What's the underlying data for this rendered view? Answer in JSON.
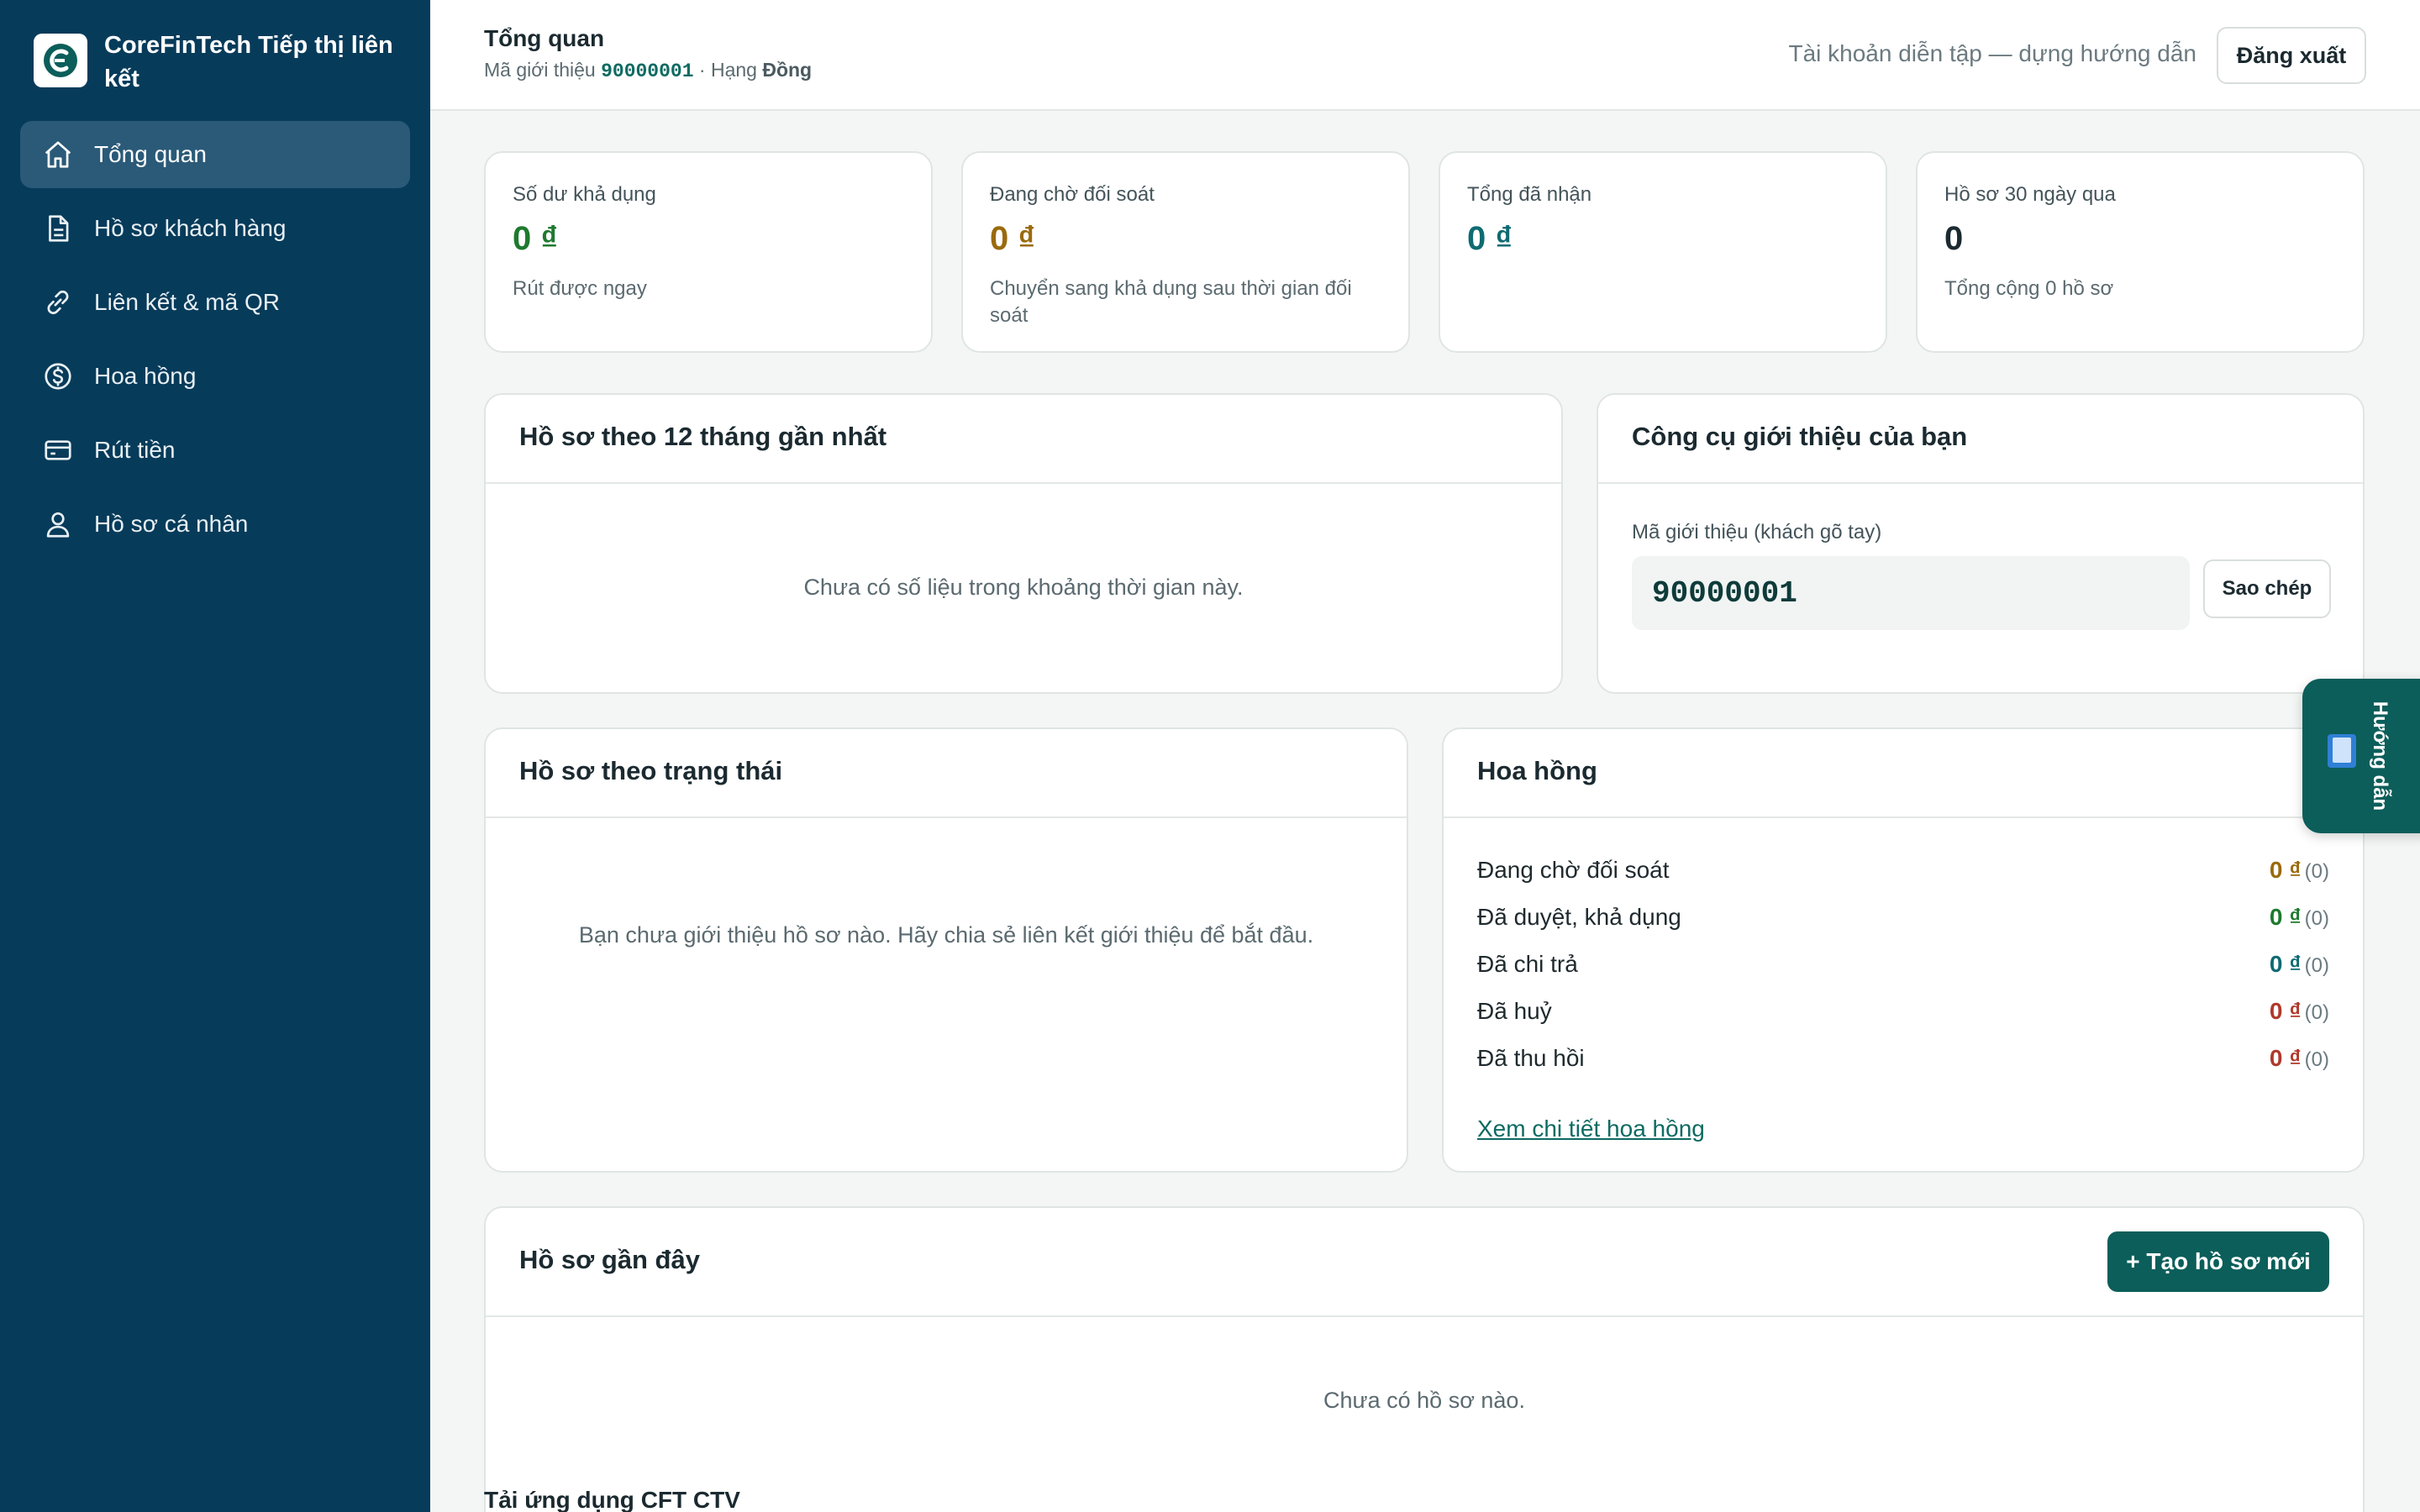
{
  "brand": {
    "name": "CoreFinTech Tiếp thị liên kết"
  },
  "nav": {
    "items": [
      {
        "label": "Tổng quan",
        "icon": "home-icon",
        "active": true
      },
      {
        "label": "Hồ sơ khách hàng",
        "icon": "document-icon"
      },
      {
        "label": "Liên kết & mã QR",
        "icon": "link-icon"
      },
      {
        "label": "Hoa hồng",
        "icon": "dollar-circle-icon"
      },
      {
        "label": "Rút tiền",
        "icon": "credit-card-icon"
      },
      {
        "label": "Hồ sơ cá nhân",
        "icon": "user-icon"
      }
    ]
  },
  "header": {
    "title": "Tổng quan",
    "sub_prefix": "Mã giới thiệu",
    "referral_code": "90000001",
    "rank_prefix": "· Hạng",
    "rank": "Đồng",
    "demo_note": "Tài khoản diễn tập — dựng hướng dẫn",
    "logout_label": "Đăng xuất"
  },
  "stats": [
    {
      "label": "Số dư khả dụng",
      "value": "0 ₫",
      "note": "Rút được ngay",
      "color": "#1e7a2e"
    },
    {
      "label": "Đang chờ đối soát",
      "value": "0 ₫",
      "note": "Chuyển sang khả dụng sau thời gian đối soát",
      "color": "#9a6a0c"
    },
    {
      "label": "Tổng đã nhận",
      "value": "0 ₫",
      "note": "",
      "color": "#0e6b72"
    },
    {
      "label": "Hồ sơ 30 ngày qua",
      "value": "0",
      "note": "Tổng cộng 0 hồ sơ",
      "color": "#1b2a30"
    }
  ],
  "monthly_panel": {
    "title": "Hồ sơ theo 12 tháng gần nhất",
    "empty": "Chưa có số liệu trong khoảng thời gian này."
  },
  "tools_panel": {
    "title": "Công cụ giới thiệu của bạn",
    "code_label": "Mã giới thiệu (khách gõ tay)",
    "code_value": "90000001",
    "copy_label": "Sao chép"
  },
  "status_panel": {
    "title": "Hồ sơ theo trạng thái",
    "empty": "Bạn chưa giới thiệu hồ sơ nào. Hãy chia sẻ liên kết giới thiệu để bắt đầu."
  },
  "commission_panel": {
    "title": "Hoa hồng",
    "rows": [
      {
        "label": "Đang chờ đối soát",
        "amount": "0 ₫",
        "count": "(0)",
        "color": "#9a6a0c"
      },
      {
        "label": "Đã duyệt, khả dụng",
        "amount": "0 ₫",
        "count": "(0)",
        "color": "#1e7a2e"
      },
      {
        "label": "Đã chi trả",
        "amount": "0 ₫",
        "count": "(0)",
        "color": "#0e6b72"
      },
      {
        "label": "Đã huỷ",
        "amount": "0 ₫",
        "count": "(0)",
        "color": "#b0392b"
      },
      {
        "label": "Đã thu hồi",
        "amount": "0 ₫",
        "count": "(0)",
        "color": "#b0392b"
      }
    ],
    "detail_link": "Xem chi tiết hoa hồng"
  },
  "recent_panel": {
    "title": "Hồ sơ gần đây",
    "create_label": "+ Tạo hồ sơ mới",
    "empty": "Chưa có hồ sơ nào."
  },
  "app_section": {
    "title": "Tải ứng dụng CFT CTV"
  },
  "guide_tab": {
    "label": "Hướng dẫn",
    "icon": "book-icon"
  }
}
